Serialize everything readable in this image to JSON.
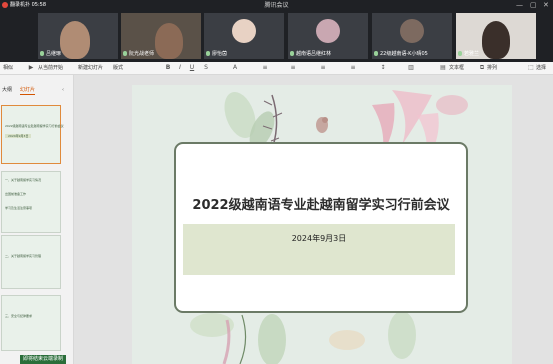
{
  "meeting": {
    "title": "腾讯会议",
    "recording": "翻录机扑 05:58",
    "participants": [
      {
        "name": "吕继琢"
      },
      {
        "name": "阮光战老师"
      },
      {
        "name": "廖怡茵"
      },
      {
        "name": "越南语吕继红林"
      },
      {
        "name": "22级越南语-K小晴05"
      },
      {
        "name": "若雅兰"
      }
    ]
  },
  "toolbar": {
    "items": [
      "相似",
      "从当前开始",
      "新建幻灯片",
      "版式",
      "文本框",
      "排列",
      "选择"
    ]
  },
  "left_pane": {
    "tabs": [
      "大纲",
      "幻灯片"
    ],
    "thumbnails": [
      {
        "lines": [
          "2022级越南语专业赴越南留学实习行前会议",
          "2024年9月3日"
        ]
      },
      {
        "lines": [
          "一、关于越南留学实习情况",
          "出国前准备工作",
          "学习及生活注意事项"
        ]
      },
      {
        "lines": [
          "二、关于越南留学实习管理"
        ]
      },
      {
        "lines": [
          "三、安全与纪律要求"
        ]
      }
    ]
  },
  "slide": {
    "title": "2022级越南语专业赴越南留学实习行前会议",
    "date": "2024年9月3日"
  },
  "notice": "即将结束云端录制"
}
